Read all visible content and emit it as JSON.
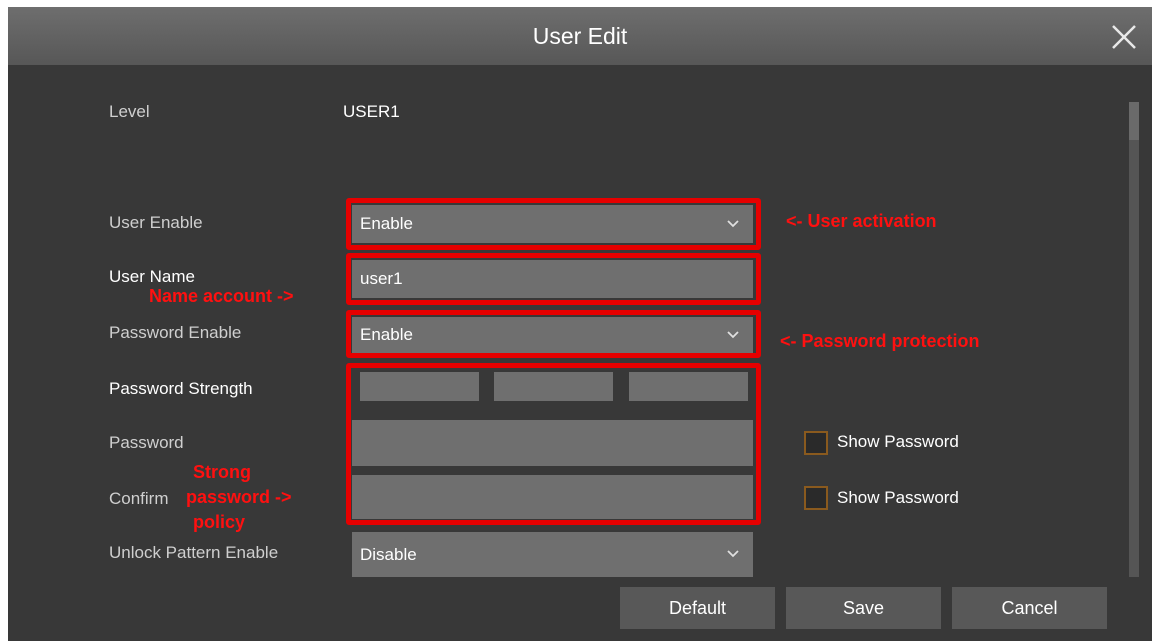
{
  "dialog": {
    "title": "User Edit",
    "close_icon": "close-icon"
  },
  "form": {
    "level_label": "Level",
    "level_value": "USER1",
    "user_enable_label": "User Enable",
    "user_enable_value": "Enable",
    "user_name_label": "User Name",
    "user_name_value": "user1",
    "password_enable_label": "Password Enable",
    "password_enable_value": "Enable",
    "password_strength_label": "Password Strength",
    "password_label": "Password",
    "confirm_label": "Confirm",
    "show_password_label": "Show Password",
    "show_password_confirm_label": "Show Password",
    "unlock_pattern_label": "Unlock Pattern Enable",
    "unlock_pattern_value": "Disable"
  },
  "annotations": {
    "user_activation": "<- User activation",
    "name_account": "Name account ->",
    "password_protection": "<- Password protection",
    "strong_line1": "Strong",
    "strong_line2": "password ->",
    "strong_line3": "policy"
  },
  "buttons": {
    "default": "Default",
    "save": "Save",
    "cancel": "Cancel"
  },
  "colors": {
    "dialog_bg": "#383838",
    "field_bg": "#6f6f6f",
    "annotation_red": "#e60000"
  }
}
